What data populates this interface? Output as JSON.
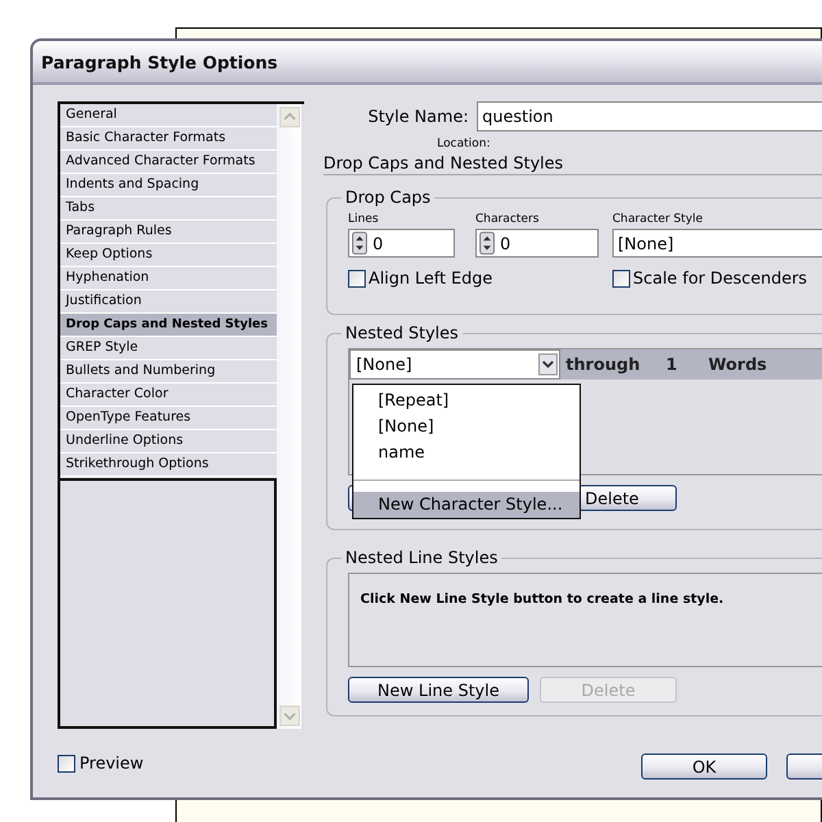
{
  "window": {
    "title": "Paragraph Style Options"
  },
  "sidebar": {
    "items": [
      {
        "label": "General",
        "selected": false
      },
      {
        "label": "Basic Character Formats",
        "selected": false
      },
      {
        "label": "Advanced Character Formats",
        "selected": false
      },
      {
        "label": "Indents and Spacing",
        "selected": false
      },
      {
        "label": "Tabs",
        "selected": false
      },
      {
        "label": "Paragraph Rules",
        "selected": false
      },
      {
        "label": "Keep Options",
        "selected": false
      },
      {
        "label": "Hyphenation",
        "selected": false
      },
      {
        "label": "Justification",
        "selected": false
      },
      {
        "label": "Drop Caps and Nested Styles",
        "selected": true
      },
      {
        "label": "GREP Style",
        "selected": false
      },
      {
        "label": "Bullets and Numbering",
        "selected": false
      },
      {
        "label": "Character Color",
        "selected": false
      },
      {
        "label": "OpenType Features",
        "selected": false
      },
      {
        "label": "Underline Options",
        "selected": false
      },
      {
        "label": "Strikethrough Options",
        "selected": false
      }
    ]
  },
  "style_name": {
    "label": "Style Name:",
    "value": "question"
  },
  "location": {
    "label": "Location:"
  },
  "section_title": "Drop Caps and Nested Styles",
  "drop_caps": {
    "title": "Drop Caps",
    "lines": {
      "label": "Lines",
      "value": "0"
    },
    "characters": {
      "label": "Characters",
      "value": "0"
    },
    "character_style": {
      "label": "Character Style",
      "value": "[None]"
    },
    "checkboxes": [
      {
        "label": "Align Left Edge",
        "checked": false
      },
      {
        "label": "Scale for Descenders",
        "checked": false
      }
    ]
  },
  "nested_styles": {
    "title": "Nested Styles",
    "row": {
      "style": "[None]",
      "through": "through",
      "count": "1",
      "unit": "Words"
    },
    "menu": [
      {
        "kind": "item",
        "label": "[Repeat]",
        "selected": false
      },
      {
        "kind": "item",
        "label": "[None]",
        "selected": false
      },
      {
        "kind": "item",
        "label": "name",
        "selected": false
      },
      {
        "kind": "separator"
      },
      {
        "kind": "item",
        "label": "New Character Style...",
        "selected": true
      }
    ],
    "delete_button": {
      "label": "Delete",
      "disabled": false
    }
  },
  "nested_line_styles": {
    "title": "Nested Line Styles",
    "message": "Click New Line Style button to create a line style.",
    "buttons": [
      {
        "label": "New Line Style",
        "disabled": false
      },
      {
        "label": "Delete",
        "disabled": true
      }
    ]
  },
  "preview": {
    "label": "Preview",
    "checked": false
  },
  "ok_button": "OK"
}
